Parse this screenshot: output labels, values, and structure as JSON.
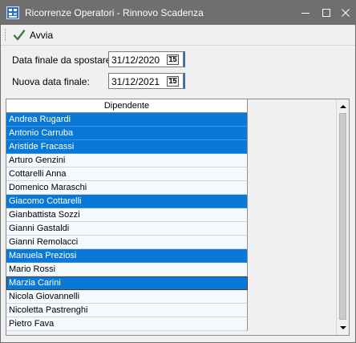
{
  "window": {
    "title": "Ricorrenze Operatori - Rinnovo Scadenza"
  },
  "toolbar": {
    "run_label": "Avvia"
  },
  "form": {
    "date_to_move_label": "Data finale da spostare:",
    "date_to_move_value": "31/12/2020",
    "new_date_label": "Nuova data finale:",
    "new_date_value": "31/12/2021",
    "calendar_glyph": "15"
  },
  "grid": {
    "column_header": "Dipendente",
    "rows": [
      {
        "name": "Andrea Rugardi",
        "selected": true
      },
      {
        "name": "Antonio Carruba",
        "selected": true
      },
      {
        "name": "Aristide Fracassi",
        "selected": true
      },
      {
        "name": "Arturo Genzini",
        "selected": false
      },
      {
        "name": "Cottarelli Anna",
        "selected": false
      },
      {
        "name": "Domenico Maraschi",
        "selected": false
      },
      {
        "name": "Giacomo Cottarelli",
        "selected": true
      },
      {
        "name": "Gianbattista Sozzi",
        "selected": false
      },
      {
        "name": "Gianni Gastaldi",
        "selected": false
      },
      {
        "name": "Gianni Remolacci",
        "selected": false
      },
      {
        "name": "Manuela Preziosi",
        "selected": true
      },
      {
        "name": "Mario Rossi",
        "selected": false
      },
      {
        "name": "Marzia Carini",
        "selected": true
      },
      {
        "name": "Nicola Giovannelli",
        "selected": false
      },
      {
        "name": "Nicoletta Pastrenghi",
        "selected": false
      },
      {
        "name": "Pietro Fava",
        "selected": false
      }
    ]
  },
  "colors": {
    "titlebar": "#6f6f6f",
    "selection": "#0a78d7",
    "row_background": "#f4f9fe"
  }
}
